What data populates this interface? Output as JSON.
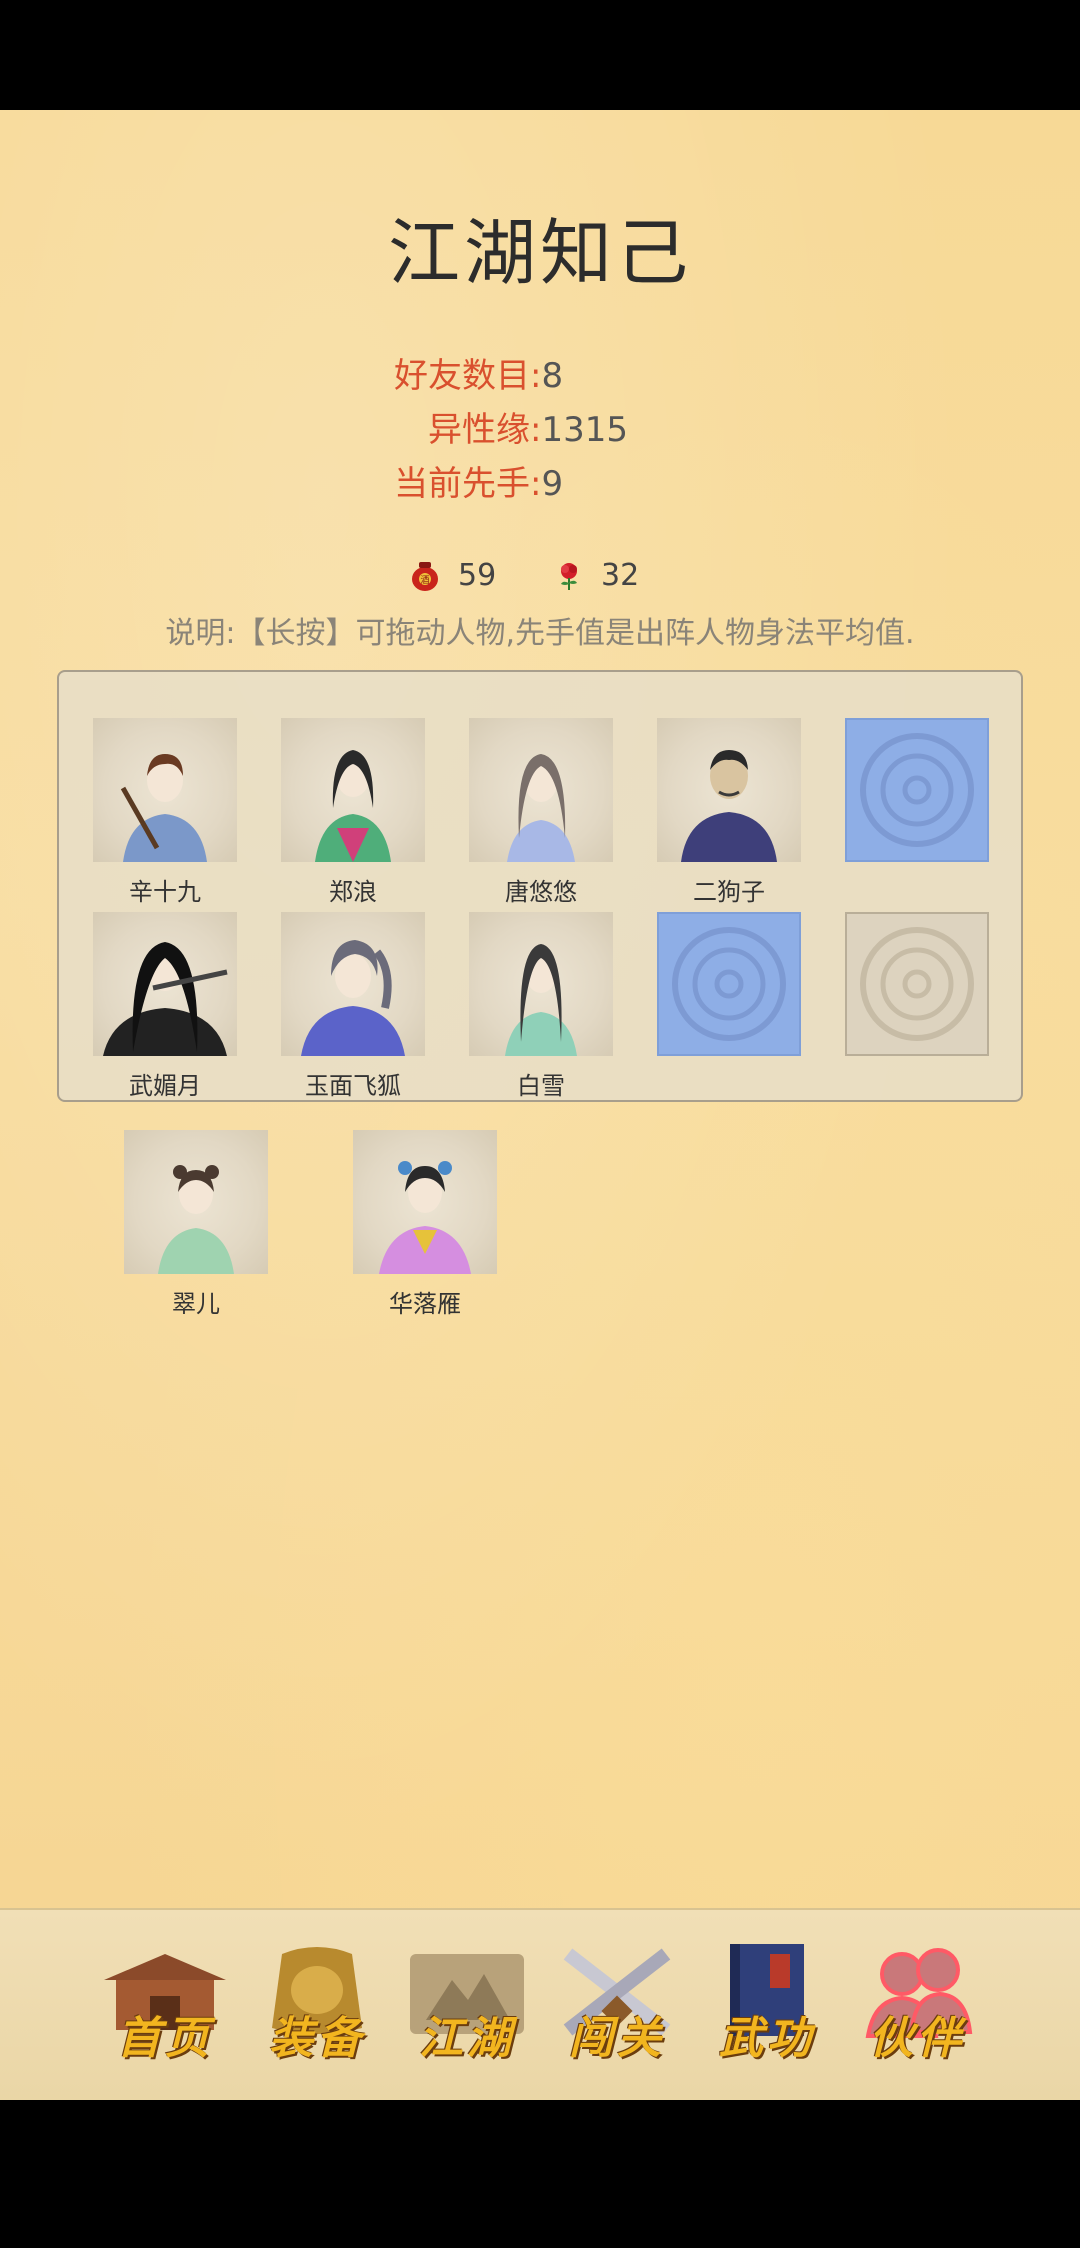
{
  "page": {
    "title": "江湖知己"
  },
  "stats": {
    "friends_label": "好友数目:",
    "friends_value": "8",
    "charm_label": "异性缘:",
    "charm_value": "1315",
    "initiative_label": "当前先手:",
    "initiative_value": "9"
  },
  "currency": {
    "wine_icon": "wine-jar-icon",
    "wine_count": "59",
    "rose_icon": "rose-icon",
    "rose_count": "32"
  },
  "note": "说明:【长按】可拖动人物,先手值是出阵人物身法平均值.",
  "team_slots": [
    {
      "name": "辛十九",
      "robe": "#7b98c9"
    },
    {
      "name": "郑浪",
      "robe": "#4fae7a"
    },
    {
      "name": "唐悠悠",
      "robe": "#a8b8e6"
    },
    {
      "name": "二狗子",
      "robe": "#3e3f7a"
    },
    {
      "name": "",
      "empty": "blue"
    },
    {
      "name": "武媚月",
      "robe": "#222222"
    },
    {
      "name": "玉面飞狐",
      "robe": "#5b63c9"
    },
    {
      "name": "白雪",
      "robe": "#8fd0b8"
    },
    {
      "name": "",
      "empty": "blue"
    },
    {
      "name": "",
      "empty": "gray"
    }
  ],
  "reserve": [
    {
      "name": "翠儿",
      "robe": "#9fd3b0"
    },
    {
      "name": "华落雁",
      "robe": "#d58ee0"
    }
  ],
  "nav": {
    "home": "首页",
    "equipment": "装备",
    "jianghu": "江湖",
    "challenge": "闯关",
    "martial": "武功",
    "partners": "伙伴"
  },
  "colors": {
    "accent_red": "#d9502e",
    "nav_gold": "#f2b51f",
    "empty_slot_blue": "#8eaee6"
  }
}
